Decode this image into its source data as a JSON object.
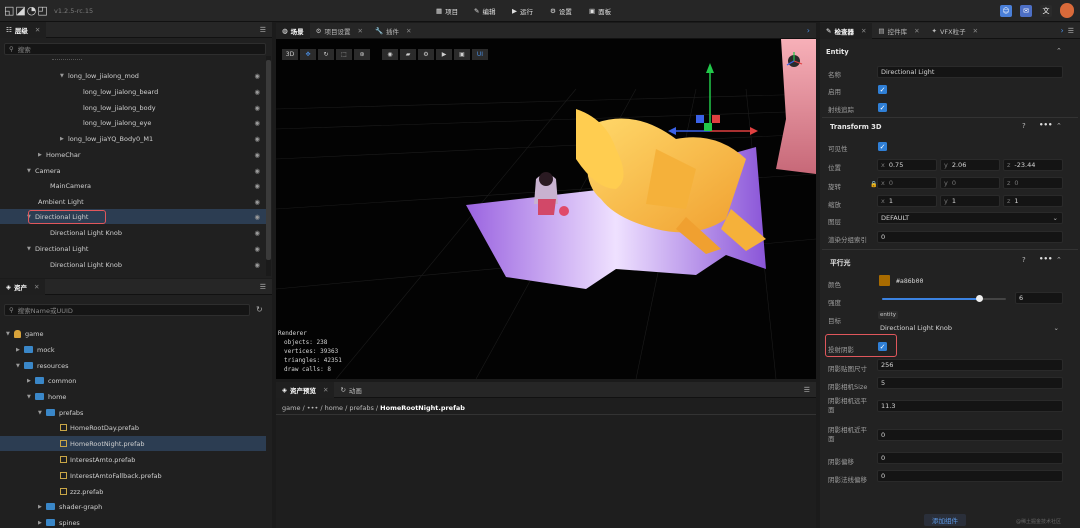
{
  "app": {
    "version": "v1.2.5-rc.15"
  },
  "menu": [
    {
      "label": "项目",
      "icon": "grid-icon"
    },
    {
      "label": "编辑",
      "icon": "pencil-icon"
    },
    {
      "label": "运行",
      "icon": "play-icon"
    },
    {
      "label": "设置",
      "icon": "gear-icon"
    },
    {
      "label": "面板",
      "icon": "panel-icon"
    }
  ],
  "hierarchy": {
    "tab": "层级",
    "search_placeholder": "搜索",
    "rows": [
      "long_low_jialong_mod",
      "long_low_jialong_beard",
      "long_low_jialong_body",
      "long_low_jialong_eye",
      "long_low_jiaYQ_Body0_M1",
      "HomeChar",
      "Camera",
      "MainCamera",
      "Ambient Light",
      "Directional Light",
      "Directional Light Knob",
      "Directional Light",
      "Directional Light Knob"
    ]
  },
  "assets": {
    "tab": "资产",
    "search_placeholder": "搜索Name或UUID",
    "rows": [
      "game",
      "mock",
      "resources",
      "common",
      "home",
      "prefabs",
      "HomeRootDay.prefab",
      "HomeRootNight.prefab",
      "InterestAmto.prefab",
      "InterestAmtoFallback.prefab",
      "zzz.prefab",
      "shader-graph",
      "spines"
    ]
  },
  "center_tabs": [
    "场景",
    "项目设置",
    "插件"
  ],
  "viewport": {
    "toolbar": [
      "3D",
      "UI"
    ],
    "renderer": {
      "title": "Renderer",
      "objects_label": "objects:",
      "objects": "238",
      "vertices_label": "vertices:",
      "vertices": "39363",
      "triangles_label": "triangles:",
      "triangles": "42351",
      "draw_calls_label": "draw calls:",
      "draw_calls": "8"
    }
  },
  "bottom_tabs": [
    "资产预览",
    "动画"
  ],
  "breadcrumb": {
    "parts": [
      "game",
      "•••",
      "home",
      "prefabs"
    ],
    "current": "HomeRootNight.prefab"
  },
  "inspector_tabs": [
    "检查器",
    "控件库",
    "VFX粒子"
  ],
  "inspector": {
    "entity_section": "Entity",
    "name_label": "名称",
    "name_value": "Directional Light",
    "enable_label": "启用",
    "raycast_label": "射线追踪",
    "transform_section": "Transform 3D",
    "visible_label": "可见性",
    "position_label": "位置",
    "position": {
      "x": "0.75",
      "y": "2.06",
      "z": "-23.44"
    },
    "rotation_label": "旋转",
    "rotation": {
      "x": "0",
      "y": "0",
      "z": "0"
    },
    "scale_label": "缩放",
    "scale": {
      "x": "1",
      "y": "1",
      "z": "1"
    },
    "layer_label": "图层",
    "layer_value": "DEFAULT",
    "render_order_label": "渲染分组索引",
    "render_order_value": "0",
    "light_section": "平行光",
    "color_label": "颜色",
    "color_value": "#a86b00",
    "color_hex": "#a86b00",
    "intensity_label": "强度",
    "intensity_value": "6",
    "intensity_fraction": 0.78,
    "target_label": "目标",
    "target_tag": "entity",
    "target_value": "Directional Light Knob",
    "cast_shadow_label": "投射阴影",
    "shadow_map_label": "阴影贴图尺寸",
    "shadow_map_value": "256",
    "shadow_cam_size_label": "阴影相机Size",
    "shadow_cam_size_value": "5",
    "shadow_cam_far_label": "阴影相机远平面",
    "shadow_cam_far_value": "11.3",
    "shadow_cam_near_label": "阴影相机近平面",
    "shadow_cam_near_value": "0",
    "shadow_bias_label": "阴影偏移",
    "shadow_bias_value": "0",
    "shadow_normal_bias_label": "阴影法线偏移",
    "shadow_normal_bias_value": "0",
    "add_component": "添加组件"
  },
  "watermark": "@稀土掘金技术社区"
}
